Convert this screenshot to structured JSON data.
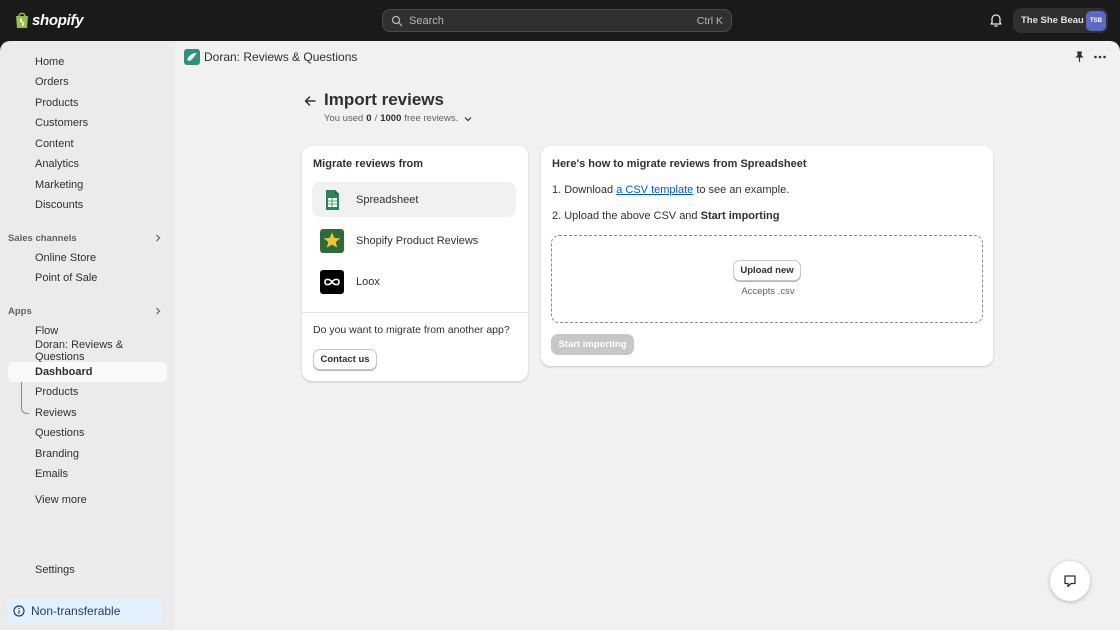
{
  "topbar": {
    "logo_text": "shopify",
    "search_placeholder": "Search",
    "search_shortcut": "Ctrl K",
    "store_name": "The She Beau",
    "avatar_initials": "TSB"
  },
  "sidebar": {
    "items": [
      {
        "label": "Home"
      },
      {
        "label": "Orders"
      },
      {
        "label": "Products"
      },
      {
        "label": "Customers"
      },
      {
        "label": "Content"
      },
      {
        "label": "Analytics"
      },
      {
        "label": "Marketing"
      },
      {
        "label": "Discounts"
      }
    ],
    "sales_channels_header": "Sales channels",
    "sales_channels": [
      {
        "label": "Online Store"
      },
      {
        "label": "Point of Sale"
      }
    ],
    "apps_header": "Apps",
    "apps": [
      {
        "label": "Flow"
      },
      {
        "label": "Doran: Reviews & Questions"
      }
    ],
    "app_subitems": [
      {
        "label": "Dashboard"
      },
      {
        "label": "Products"
      },
      {
        "label": "Reviews"
      },
      {
        "label": "Questions"
      },
      {
        "label": "Branding"
      },
      {
        "label": "Emails"
      }
    ],
    "view_more": "View more",
    "settings": "Settings",
    "non_transferable": "Non-transferable"
  },
  "app_header": {
    "title": "Doran: Reviews & Questions"
  },
  "page": {
    "title": "Import reviews",
    "usage_prefix": "You used",
    "usage_used": "0",
    "usage_sep": "/",
    "usage_limit": "1000",
    "usage_suffix": "free reviews."
  },
  "migrate_card": {
    "title": "Migrate reviews from",
    "sources": [
      {
        "label": "Spreadsheet",
        "icon": "spreadsheet-icon"
      },
      {
        "label": "Shopify Product Reviews",
        "icon": "star-icon"
      },
      {
        "label": "Loox",
        "icon": "loox-icon"
      }
    ],
    "other_question": "Do you want to migrate from another app?",
    "contact_button": "Contact us"
  },
  "howto_card": {
    "title": "Here's how to migrate reviews from Spreadsheet",
    "step1_prefix": "1. Download",
    "step1_link": "a CSV template",
    "step1_suffix": "to see an example.",
    "step2_prefix": "2. Upload the above CSV and",
    "step2_bold": "Start importing",
    "upload_button": "Upload new",
    "accepts": "Accepts .csv",
    "start_button": "Start importing"
  },
  "colors": {
    "topbar": "#1a1a1a",
    "sidebar": "#ebebeb",
    "main_bg": "#f1f1f1",
    "link": "#005bd3",
    "spreadsheet_green": "#29845a"
  }
}
